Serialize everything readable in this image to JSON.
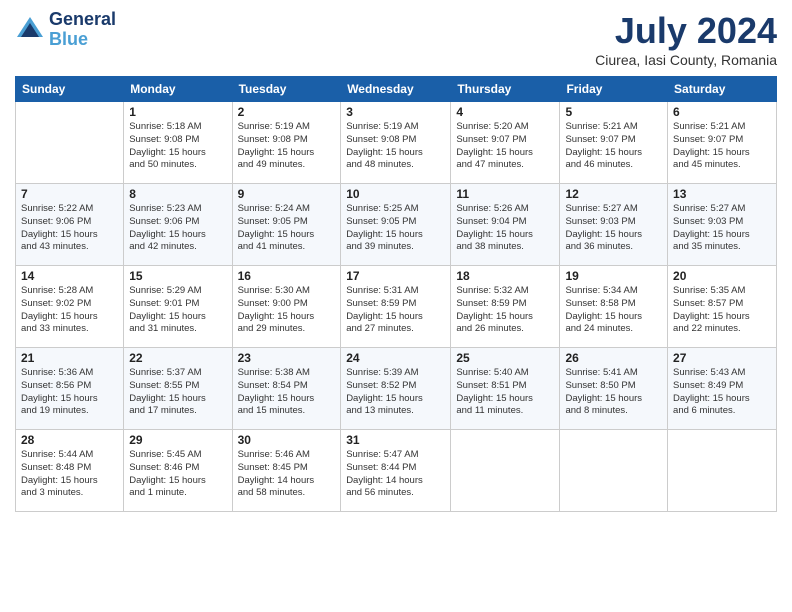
{
  "header": {
    "logo_line1": "General",
    "logo_line2": "Blue",
    "month_year": "July 2024",
    "location": "Ciurea, Iasi County, Romania"
  },
  "columns": [
    "Sunday",
    "Monday",
    "Tuesday",
    "Wednesday",
    "Thursday",
    "Friday",
    "Saturday"
  ],
  "weeks": [
    [
      {
        "day": "",
        "info": ""
      },
      {
        "day": "1",
        "info": "Sunrise: 5:18 AM\nSunset: 9:08 PM\nDaylight: 15 hours\nand 50 minutes."
      },
      {
        "day": "2",
        "info": "Sunrise: 5:19 AM\nSunset: 9:08 PM\nDaylight: 15 hours\nand 49 minutes."
      },
      {
        "day": "3",
        "info": "Sunrise: 5:19 AM\nSunset: 9:08 PM\nDaylight: 15 hours\nand 48 minutes."
      },
      {
        "day": "4",
        "info": "Sunrise: 5:20 AM\nSunset: 9:07 PM\nDaylight: 15 hours\nand 47 minutes."
      },
      {
        "day": "5",
        "info": "Sunrise: 5:21 AM\nSunset: 9:07 PM\nDaylight: 15 hours\nand 46 minutes."
      },
      {
        "day": "6",
        "info": "Sunrise: 5:21 AM\nSunset: 9:07 PM\nDaylight: 15 hours\nand 45 minutes."
      }
    ],
    [
      {
        "day": "7",
        "info": "Sunrise: 5:22 AM\nSunset: 9:06 PM\nDaylight: 15 hours\nand 43 minutes."
      },
      {
        "day": "8",
        "info": "Sunrise: 5:23 AM\nSunset: 9:06 PM\nDaylight: 15 hours\nand 42 minutes."
      },
      {
        "day": "9",
        "info": "Sunrise: 5:24 AM\nSunset: 9:05 PM\nDaylight: 15 hours\nand 41 minutes."
      },
      {
        "day": "10",
        "info": "Sunrise: 5:25 AM\nSunset: 9:05 PM\nDaylight: 15 hours\nand 39 minutes."
      },
      {
        "day": "11",
        "info": "Sunrise: 5:26 AM\nSunset: 9:04 PM\nDaylight: 15 hours\nand 38 minutes."
      },
      {
        "day": "12",
        "info": "Sunrise: 5:27 AM\nSunset: 9:03 PM\nDaylight: 15 hours\nand 36 minutes."
      },
      {
        "day": "13",
        "info": "Sunrise: 5:27 AM\nSunset: 9:03 PM\nDaylight: 15 hours\nand 35 minutes."
      }
    ],
    [
      {
        "day": "14",
        "info": "Sunrise: 5:28 AM\nSunset: 9:02 PM\nDaylight: 15 hours\nand 33 minutes."
      },
      {
        "day": "15",
        "info": "Sunrise: 5:29 AM\nSunset: 9:01 PM\nDaylight: 15 hours\nand 31 minutes."
      },
      {
        "day": "16",
        "info": "Sunrise: 5:30 AM\nSunset: 9:00 PM\nDaylight: 15 hours\nand 29 minutes."
      },
      {
        "day": "17",
        "info": "Sunrise: 5:31 AM\nSunset: 8:59 PM\nDaylight: 15 hours\nand 27 minutes."
      },
      {
        "day": "18",
        "info": "Sunrise: 5:32 AM\nSunset: 8:59 PM\nDaylight: 15 hours\nand 26 minutes."
      },
      {
        "day": "19",
        "info": "Sunrise: 5:34 AM\nSunset: 8:58 PM\nDaylight: 15 hours\nand 24 minutes."
      },
      {
        "day": "20",
        "info": "Sunrise: 5:35 AM\nSunset: 8:57 PM\nDaylight: 15 hours\nand 22 minutes."
      }
    ],
    [
      {
        "day": "21",
        "info": "Sunrise: 5:36 AM\nSunset: 8:56 PM\nDaylight: 15 hours\nand 19 minutes."
      },
      {
        "day": "22",
        "info": "Sunrise: 5:37 AM\nSunset: 8:55 PM\nDaylight: 15 hours\nand 17 minutes."
      },
      {
        "day": "23",
        "info": "Sunrise: 5:38 AM\nSunset: 8:54 PM\nDaylight: 15 hours\nand 15 minutes."
      },
      {
        "day": "24",
        "info": "Sunrise: 5:39 AM\nSunset: 8:52 PM\nDaylight: 15 hours\nand 13 minutes."
      },
      {
        "day": "25",
        "info": "Sunrise: 5:40 AM\nSunset: 8:51 PM\nDaylight: 15 hours\nand 11 minutes."
      },
      {
        "day": "26",
        "info": "Sunrise: 5:41 AM\nSunset: 8:50 PM\nDaylight: 15 hours\nand 8 minutes."
      },
      {
        "day": "27",
        "info": "Sunrise: 5:43 AM\nSunset: 8:49 PM\nDaylight: 15 hours\nand 6 minutes."
      }
    ],
    [
      {
        "day": "28",
        "info": "Sunrise: 5:44 AM\nSunset: 8:48 PM\nDaylight: 15 hours\nand 3 minutes."
      },
      {
        "day": "29",
        "info": "Sunrise: 5:45 AM\nSunset: 8:46 PM\nDaylight: 15 hours\nand 1 minute."
      },
      {
        "day": "30",
        "info": "Sunrise: 5:46 AM\nSunset: 8:45 PM\nDaylight: 14 hours\nand 58 minutes."
      },
      {
        "day": "31",
        "info": "Sunrise: 5:47 AM\nSunset: 8:44 PM\nDaylight: 14 hours\nand 56 minutes."
      },
      {
        "day": "",
        "info": ""
      },
      {
        "day": "",
        "info": ""
      },
      {
        "day": "",
        "info": ""
      }
    ]
  ]
}
